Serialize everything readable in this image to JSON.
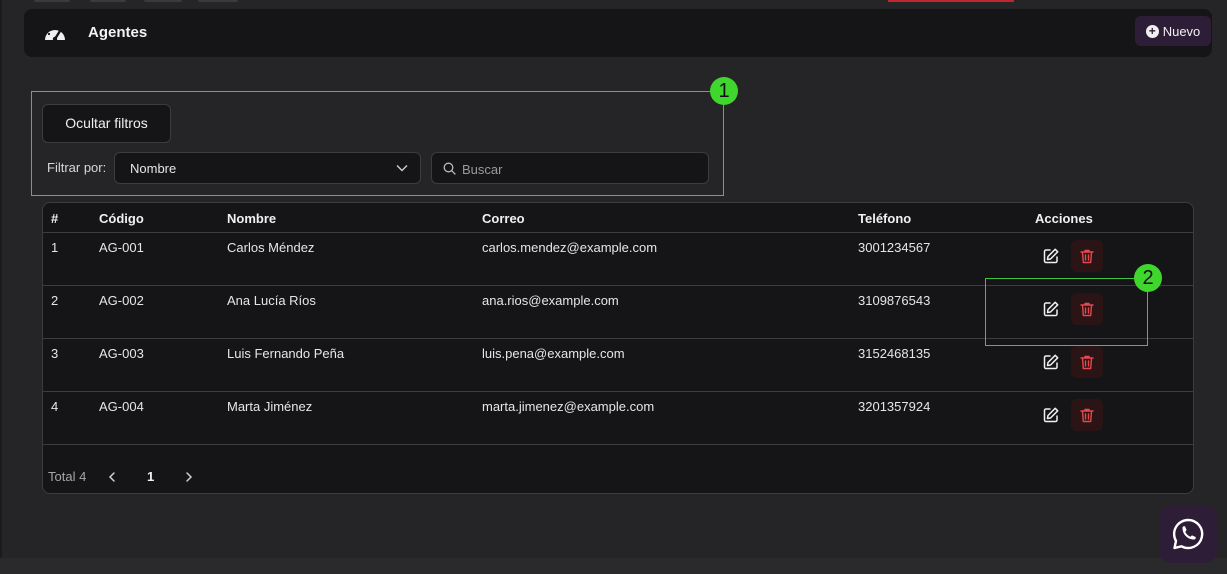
{
  "header": {
    "title": "Agentes",
    "new_button_label": "Nuevo"
  },
  "annotations": [
    "1",
    "2"
  ],
  "filters": {
    "toggle_label": "Ocultar filtros",
    "filter_by_label": "Filtrar por:",
    "filter_by_value": "Nombre",
    "search_placeholder": "Buscar"
  },
  "table": {
    "columns": [
      "#",
      "Código",
      "Nombre",
      "Correo",
      "Teléfono",
      "Acciones"
    ],
    "rows": [
      {
        "num": "1",
        "code": "AG-001",
        "name": "Carlos Méndez",
        "email": "carlos.mendez@example.com",
        "phone": "3001234567"
      },
      {
        "num": "2",
        "code": "AG-002",
        "name": "Ana Lucía Ríos",
        "email": "ana.rios@example.com",
        "phone": "3109876543"
      },
      {
        "num": "3",
        "code": "AG-003",
        "name": "Luis Fernando Peña",
        "email": "luis.pena@example.com",
        "phone": "3152468135"
      },
      {
        "num": "4",
        "code": "AG-004",
        "name": "Marta Jiménez",
        "email": "marta.jimenez@example.com",
        "phone": "3201357924"
      }
    ]
  },
  "pagination": {
    "total_label": "Total 4",
    "current_page": "1"
  },
  "icons": {
    "header": "dashboard-gauge-icon",
    "new": "plus-circle-icon",
    "select": "chevron-down-icon",
    "search": "search-icon",
    "edit": "edit-icon",
    "delete": "trash-icon",
    "prev": "chevron-left-icon",
    "next": "chevron-right-icon",
    "chat": "whatsapp-icon"
  },
  "colors": {
    "background": "#252527",
    "panel": "#151517",
    "accent": "#2e1d36",
    "danger": "#e5484d",
    "annotation": "#3fd62e"
  }
}
